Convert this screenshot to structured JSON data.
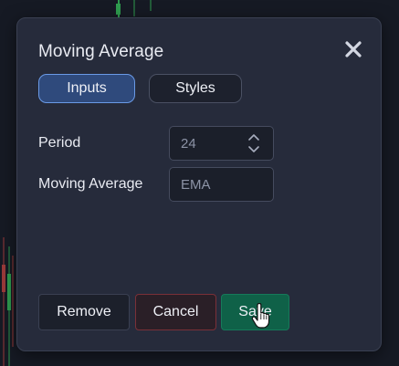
{
  "dialog": {
    "title": "Moving Average",
    "close_icon": "close-x-icon"
  },
  "tabs": [
    {
      "label": "Inputs",
      "active": true
    },
    {
      "label": "Styles",
      "active": false
    }
  ],
  "fields": {
    "period": {
      "label": "Period",
      "value": "24"
    },
    "moving_average": {
      "label": "Moving Average",
      "value": "EMA"
    }
  },
  "buttons": {
    "remove": "Remove",
    "cancel": "Cancel",
    "save": "Save"
  },
  "colors": {
    "dialog_bg": "#262b3b",
    "active_tab_border": "#6a9ae6",
    "cancel_border": "#7a3038",
    "save_bg": "#0f6148"
  }
}
